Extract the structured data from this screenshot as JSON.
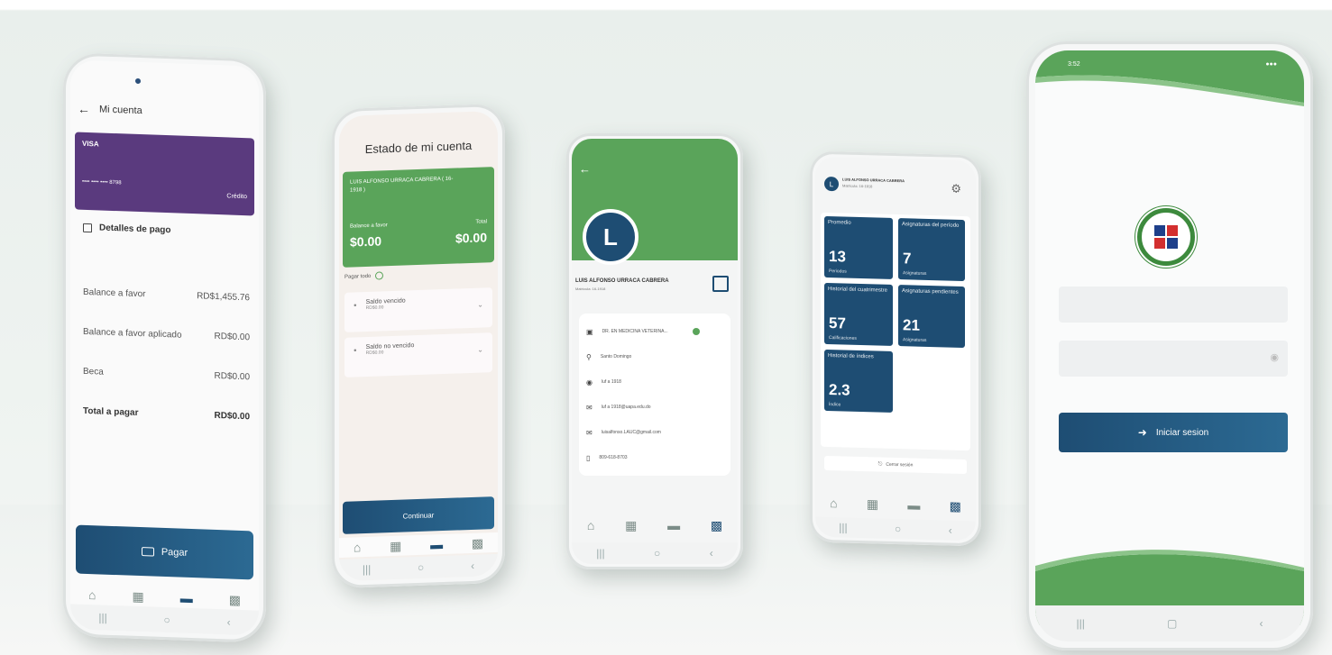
{
  "phone1": {
    "back_icon": "arrow-left-icon",
    "title": "Mi cuenta",
    "card": {
      "brand": "VISA",
      "number": "•••• •••• •••• 8798",
      "type": "Crédito",
      "color": "#5a3a7e"
    },
    "section_title": "Detalles de pago",
    "rows": [
      {
        "label": "Balance a favor",
        "value": "RD$1,455.76"
      },
      {
        "label": "Balance a favor aplicado",
        "value": "RD$0.00"
      },
      {
        "label": "Beca",
        "value": "RD$0.00"
      },
      {
        "label": "Total a pagar",
        "value": "RD$0.00"
      }
    ],
    "pay_button": "Pagar"
  },
  "phone2": {
    "title": "Estado de mi cuenta",
    "student": "LUIS ALFONSO URRACA CABRERA ( 16-1918 )",
    "balance_label": "Balance a favor",
    "balance_value": "$0.00",
    "total_label": "Total",
    "total_value": "$0.00",
    "pay_all_label": "Pagar todo",
    "items": [
      {
        "label": "Saldo vencido",
        "value": "RD$0.00"
      },
      {
        "label": "Saldo no vencido",
        "value": "RD$0.00"
      }
    ],
    "continue_button": "Continuar"
  },
  "phone3": {
    "avatar_letter": "L",
    "name": "LUIS ALFONSO URRACA CABRERA",
    "subtitle": "Matrícula: 16-1918",
    "details": [
      {
        "icon": "id-card-icon",
        "text": "DR. EN MEDICINA VETERINA..."
      },
      {
        "icon": "location-pin-icon",
        "text": "Santo Domingo"
      },
      {
        "icon": "user-circle-icon",
        "text": "luf a 1918"
      },
      {
        "icon": "mail-icon",
        "text": "luf a 1918@uapa.edu.do"
      },
      {
        "icon": "mail-icon",
        "text": "luisalfonso.LAUC@gmail.com"
      },
      {
        "icon": "phone-icon",
        "text": "809-618-8703"
      }
    ],
    "brand_color": "#5aa45a"
  },
  "phone4": {
    "avatar_letter": "L",
    "name": "LUIS ALFONSO URRACA CABRERA",
    "subtitle": "Matrícula: 16-1918",
    "tiles": [
      {
        "title": "Promedio",
        "number": "13",
        "sub": "Periodos"
      },
      {
        "title": "Asignaturas del período",
        "number": "7",
        "sub": "Asignaturas"
      },
      {
        "title": "Historial del cuatrimestre",
        "number": "57",
        "sub": "Calificaciones"
      },
      {
        "title": "Asignaturas pendientes",
        "number": "21",
        "sub": "Asignaturas"
      },
      {
        "title": "Historial de índices",
        "number": "2.3",
        "sub": "Índice"
      }
    ],
    "logout": "Cerrar sesión"
  },
  "phone5": {
    "status_time": "3:52",
    "login_button": "Iniciar sesion",
    "brand_color": "#5aa45a",
    "button_color": "#1e4d73"
  }
}
